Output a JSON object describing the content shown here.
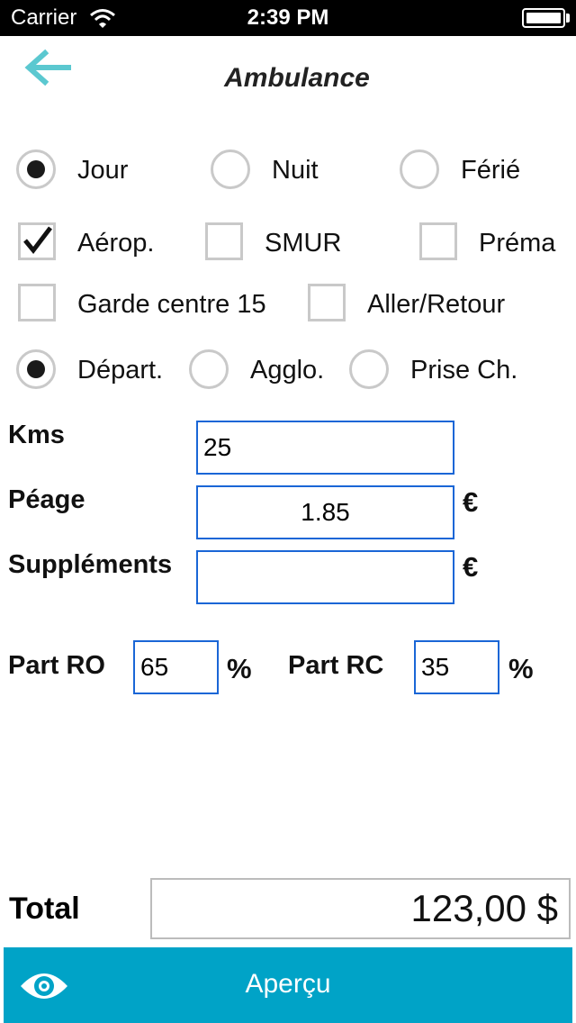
{
  "status_bar": {
    "carrier": "Carrier",
    "time": "2:39 PM"
  },
  "nav": {
    "title": "Ambulance",
    "back_icon": "arrow-left-icon"
  },
  "period_options": [
    {
      "label": "Jour",
      "selected": true
    },
    {
      "label": "Nuit",
      "selected": false
    },
    {
      "label": "Férié",
      "selected": false
    }
  ],
  "flags_row1": [
    {
      "label": "Aérop.",
      "checked": true
    },
    {
      "label": "SMUR",
      "checked": false
    },
    {
      "label": "Préma",
      "checked": false
    }
  ],
  "flags_row2": [
    {
      "label": "Garde centre 15",
      "checked": false
    },
    {
      "label": "Aller/Retour",
      "checked": false
    }
  ],
  "zone_options": [
    {
      "label": "Départ.",
      "selected": true
    },
    {
      "label": "Agglo.",
      "selected": false
    },
    {
      "label": "Prise Ch.",
      "selected": false
    }
  ],
  "fields": {
    "kms": {
      "label": "Kms",
      "value": "25"
    },
    "peage": {
      "label": "Péage",
      "value": "1.85",
      "unit": "€"
    },
    "supplements": {
      "label": "Suppléments",
      "value": "",
      "unit": "€"
    }
  },
  "parts": {
    "ro": {
      "label": "Part RO",
      "value": "65",
      "unit": "%"
    },
    "rc": {
      "label": "Part RC",
      "value": "35",
      "unit": "%"
    }
  },
  "total": {
    "label": "Total",
    "value": "123,00 $"
  },
  "bottom": {
    "button_label": "Aperçu",
    "icon": "eye-icon"
  },
  "colors": {
    "accent": "#00a3c7",
    "back_arrow": "#5bc8d0",
    "input_border": "#1a66d6"
  }
}
